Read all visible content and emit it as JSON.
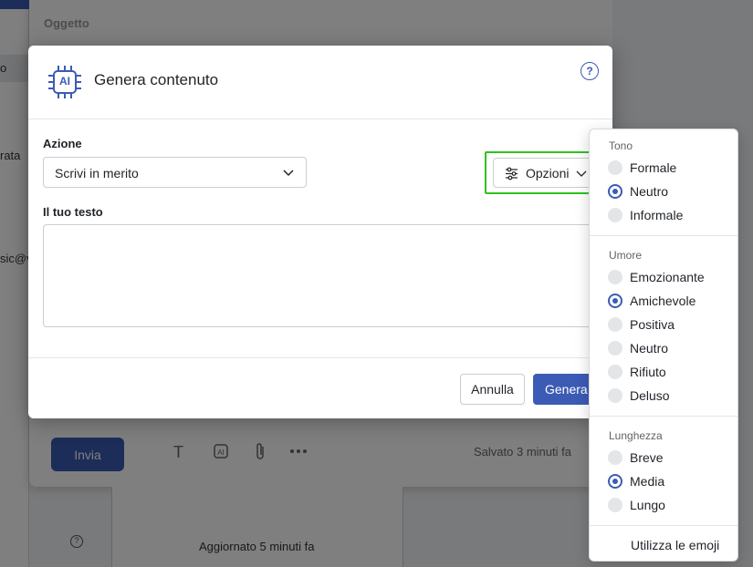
{
  "background": {
    "left_texts": [
      "o",
      "rata",
      "sic@v"
    ],
    "subject_label": "Oggetto",
    "send_button": "Invia",
    "saved_status": "Salvato 3 minuti fa",
    "updated_status": "Aggiornato 5 minuti fa",
    "help_glyph": "?",
    "toolbar_icons": [
      "text-format-icon",
      "ai-icon",
      "attachment-icon",
      "more-icon"
    ]
  },
  "modal": {
    "title": "Genera contenuto",
    "help_glyph": "?",
    "ai_badge": "AI",
    "action_label": "Azione",
    "action_value": "Scrivi in merito",
    "options_label": "Opzioni",
    "text_label": "Il tuo testo",
    "text_value": "",
    "cancel_label": "Annulla",
    "generate_label": "Genera"
  },
  "dropdown": {
    "groups": [
      {
        "label": "Tono",
        "options": [
          {
            "label": "Formale",
            "selected": false
          },
          {
            "label": "Neutro",
            "selected": true
          },
          {
            "label": "Informale",
            "selected": false
          }
        ]
      },
      {
        "label": "Umore",
        "options": [
          {
            "label": "Emozionante",
            "selected": false
          },
          {
            "label": "Amichevole",
            "selected": true
          },
          {
            "label": "Positiva",
            "selected": false
          },
          {
            "label": "Neutro",
            "selected": false
          },
          {
            "label": "Rifiuto",
            "selected": false
          },
          {
            "label": "Deluso",
            "selected": false
          }
        ]
      },
      {
        "label": "Lunghezza",
        "options": [
          {
            "label": "Breve",
            "selected": false
          },
          {
            "label": "Media",
            "selected": true
          },
          {
            "label": "Lungo",
            "selected": false
          }
        ]
      }
    ],
    "emoji_label": "Utilizza le emoji"
  },
  "colors": {
    "accent": "#3b5bb5",
    "highlight": "#2fc21f"
  }
}
